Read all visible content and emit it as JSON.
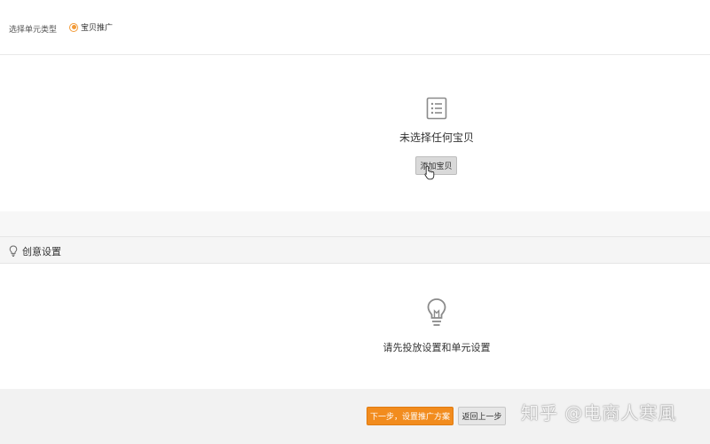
{
  "unit_type": {
    "label": "选择单元类型",
    "selected_option": "宝贝推广"
  },
  "item_section": {
    "empty_text": "未选择任何宝贝",
    "add_button_label": "添加宝贝"
  },
  "creative_section": {
    "title": "创意设置",
    "empty_text": "请先投放设置和单元设置"
  },
  "footer": {
    "next_button_label": "下一步，设置推广方案",
    "back_button_label": "返回上一步"
  },
  "watermark": {
    "text": "知乎 @电商人寒風"
  },
  "colors": {
    "accent": "#f28c1e",
    "radio": "#f29a38"
  },
  "icons": {
    "empty_list": "list-document-icon",
    "cursor": "hand-pointer-icon",
    "creative_header": "lightbulb-icon",
    "creative_empty": "lightbulb-icon"
  }
}
